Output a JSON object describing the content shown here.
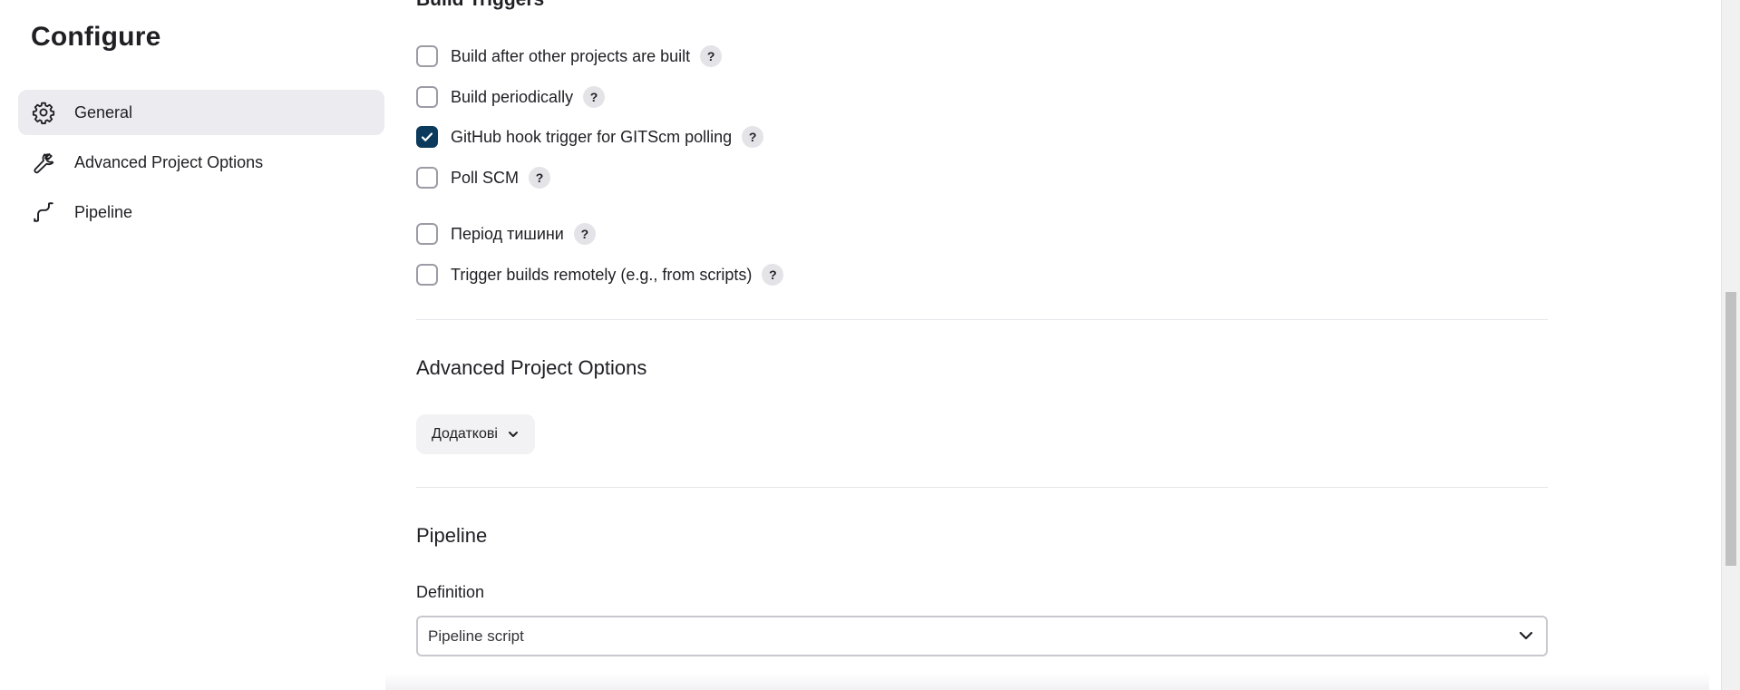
{
  "sidebar": {
    "title": "Configure",
    "items": [
      {
        "label": "General",
        "icon": "gear-icon",
        "active": true
      },
      {
        "label": "Advanced Project Options",
        "icon": "wrench-icon",
        "active": false
      },
      {
        "label": "Pipeline",
        "icon": "pipeline-icon",
        "active": false
      }
    ]
  },
  "build_triggers": {
    "title": "Build Triggers",
    "items": [
      {
        "label": "Build after other projects are built",
        "checked": false,
        "help": "?"
      },
      {
        "label": "Build periodically",
        "checked": false,
        "help": "?"
      },
      {
        "label": "GitHub hook trigger for GITScm polling",
        "checked": true,
        "help": "?"
      },
      {
        "label": "Poll SCM",
        "checked": false,
        "help": "?"
      },
      {
        "label": "Період тишини",
        "checked": false,
        "help": "?"
      },
      {
        "label": "Trigger builds remotely (e.g., from scripts)",
        "checked": false,
        "help": "?"
      }
    ]
  },
  "advanced": {
    "title": "Advanced Project Options",
    "button_label": "Додаткові"
  },
  "pipeline": {
    "title": "Pipeline",
    "definition_label": "Definition",
    "definition_value": "Pipeline script"
  },
  "colors": {
    "checkbox_checked": "#0b3a5c",
    "active_nav_bg": "#ebebf0"
  }
}
